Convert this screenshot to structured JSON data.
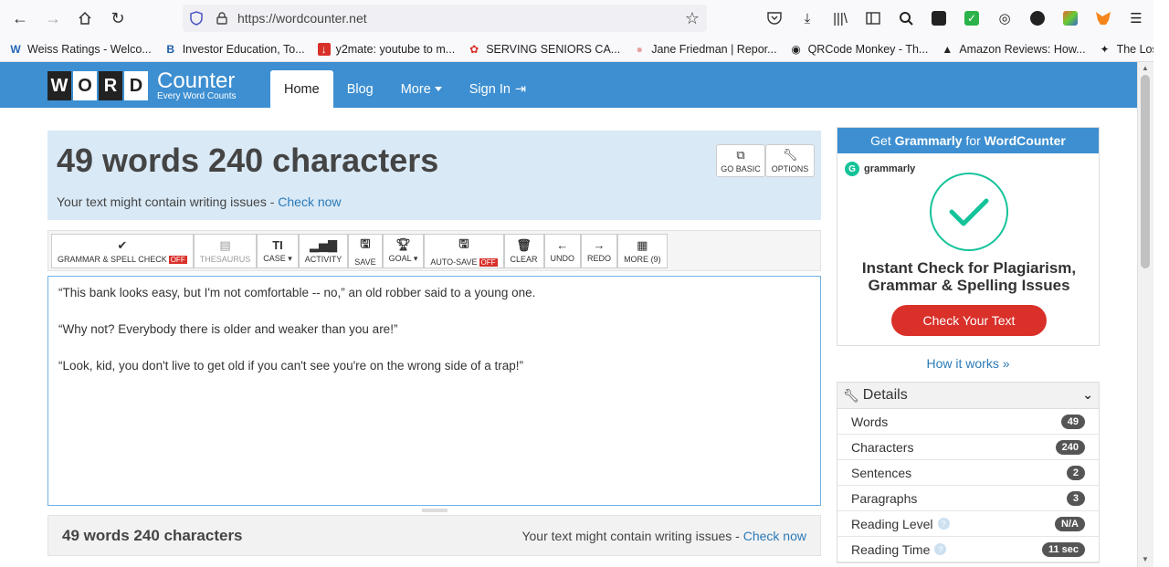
{
  "browser": {
    "url": "https://wordcounter.net",
    "bookmarks": [
      {
        "label": "Weiss Ratings - Welco...",
        "icon": "W"
      },
      {
        "label": "Investor Education, To...",
        "icon": "B"
      },
      {
        "label": "y2mate: youtube to m...",
        "icon": "↓"
      },
      {
        "label": "SERVING SENIORS CA...",
        "icon": "✿"
      },
      {
        "label": "Jane Friedman | Repor...",
        "icon": "●"
      },
      {
        "label": "QRCode Monkey - Th...",
        "icon": "◉"
      },
      {
        "label": "Amazon Reviews: How...",
        "icon": "▲"
      },
      {
        "label": "The Lost Ways",
        "icon": "✦"
      }
    ]
  },
  "site": {
    "logo_letters": [
      "W",
      "O",
      "R",
      "D"
    ],
    "logo_counter": "Counter",
    "logo_tagline": "Every Word Counts",
    "nav": [
      {
        "label": "Home",
        "active": true
      },
      {
        "label": "Blog"
      },
      {
        "label": "More"
      },
      {
        "label": "Sign In"
      }
    ]
  },
  "counts": {
    "title": "49 words 240 characters",
    "issue_text": "Your text might contain writing issues - ",
    "issue_link": "Check now",
    "go_basic": "GO BASIC",
    "options": "OPTIONS"
  },
  "toolbar": {
    "grammar": "GRAMMAR & SPELL CHECK",
    "off": "OFF",
    "thesaurus": "THESAURUS",
    "case": "CASE",
    "activity": "ACTIVITY",
    "save": "SAVE",
    "goal": "GOAL",
    "autosave": "AUTO-SAVE",
    "clear": "CLEAR",
    "undo": "UNDO",
    "redo": "REDO",
    "more": "MORE (9)"
  },
  "editor": {
    "paragraphs": [
      "“This bank looks easy, but I'm not comfortable -- no,” an old robber said to a young one.",
      "“Why not? Everybody there is older and weaker than you are!”",
      "“Look, kid, you don't live to get old if you can't see you're on the wrong side of a trap!”"
    ]
  },
  "bottom": {
    "count": "49 words 240 characters",
    "issue_text": "Your text might contain writing issues - ",
    "issue_link": "Check now"
  },
  "ad": {
    "header_prefix": "Get ",
    "header_brand": "Grammarly",
    "header_mid": " for ",
    "header_site": "WordCounter",
    "brand": "grammarly",
    "title_line1": "Instant Check for Plagiarism,",
    "title_line2": "Grammar & Spelling Issues",
    "cta": "Check Your Text"
  },
  "how_it_works": "How it works »",
  "details": {
    "title": "Details",
    "rows": [
      {
        "label": "Words",
        "value": "49"
      },
      {
        "label": "Characters",
        "value": "240"
      },
      {
        "label": "Sentences",
        "value": "2"
      },
      {
        "label": "Paragraphs",
        "value": "3"
      },
      {
        "label": "Reading Level",
        "value": "N/A"
      },
      {
        "label": "Reading Time",
        "value": "11 sec"
      }
    ]
  },
  "colors": {
    "header_blue": "#3d8fd1",
    "panel_blue": "#d9e9f6",
    "cta_red": "#d9302a",
    "grammarly_green": "#15c39a"
  }
}
